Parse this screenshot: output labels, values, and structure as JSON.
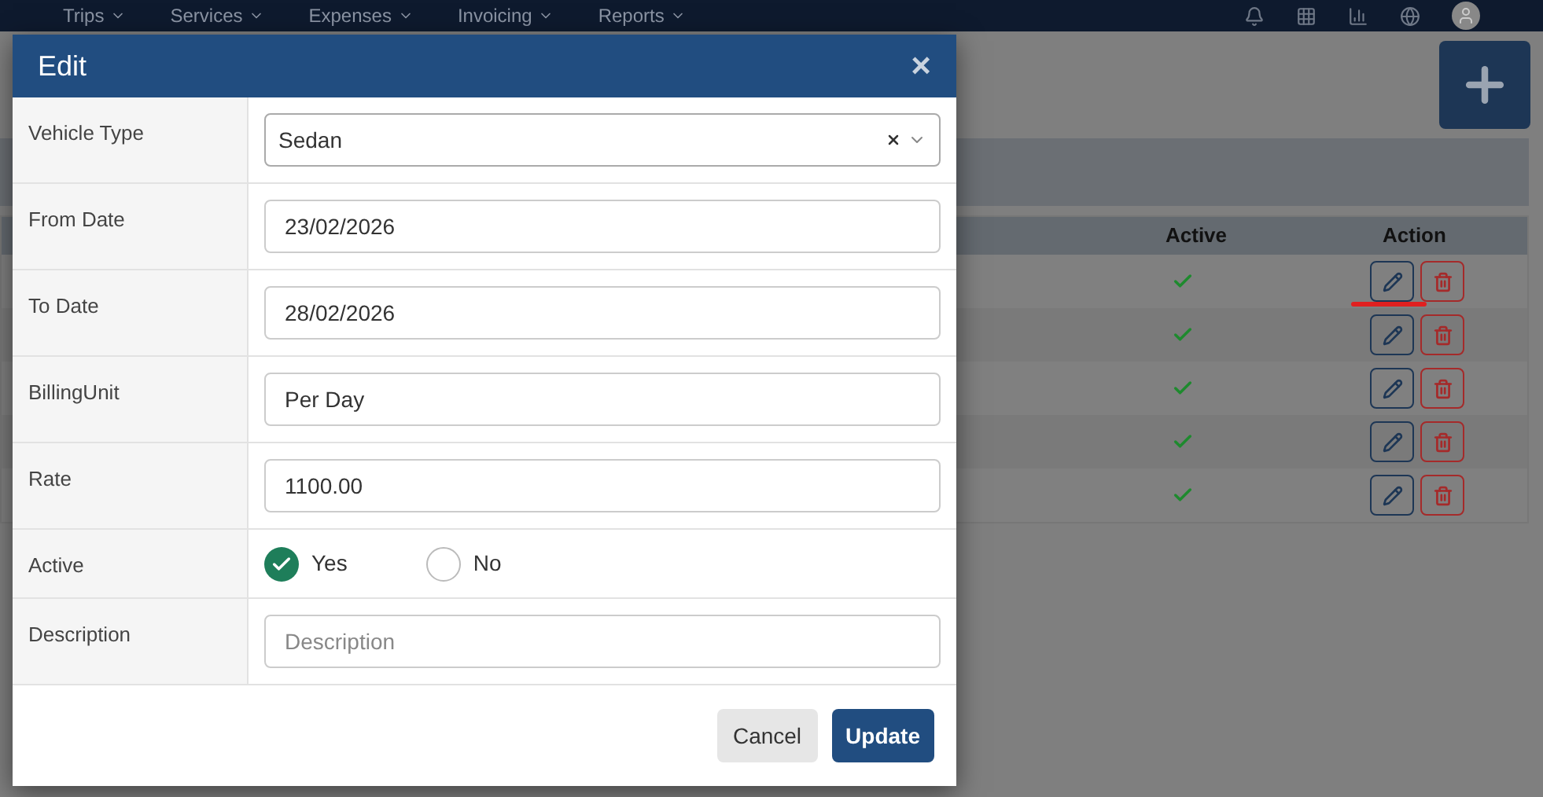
{
  "nav": {
    "items": [
      "Trips",
      "Services",
      "Expenses",
      "Invoicing",
      "Reports"
    ]
  },
  "table": {
    "columns": [
      "Active",
      "Action"
    ],
    "rows": [
      {
        "active": true,
        "annotated": true
      },
      {
        "active": true,
        "annotated": false
      },
      {
        "active": true,
        "annotated": false
      },
      {
        "active": true,
        "annotated": false
      },
      {
        "active": true,
        "annotated": false
      }
    ]
  },
  "modal": {
    "title": "Edit",
    "close": "×",
    "fields": [
      {
        "kind": "select",
        "label": "Vehicle Type",
        "value": "Sedan"
      },
      {
        "kind": "input",
        "label": "From Date",
        "value": "23/02/2026"
      },
      {
        "kind": "input",
        "label": "To Date",
        "value": "28/02/2026"
      },
      {
        "kind": "input",
        "label": "BillingUnit",
        "value": "Per Day"
      },
      {
        "kind": "input",
        "label": "Rate",
        "value": "1100.00"
      },
      {
        "kind": "radio",
        "label": "Active",
        "options": [
          {
            "label": "Yes",
            "selected": true
          },
          {
            "label": "No",
            "selected": false
          }
        ]
      },
      {
        "kind": "input",
        "label": "Description",
        "placeholder": "Description"
      }
    ],
    "buttons": [
      {
        "label": "Cancel",
        "kind": "secondary"
      },
      {
        "label": "Update",
        "kind": "primary"
      }
    ]
  }
}
